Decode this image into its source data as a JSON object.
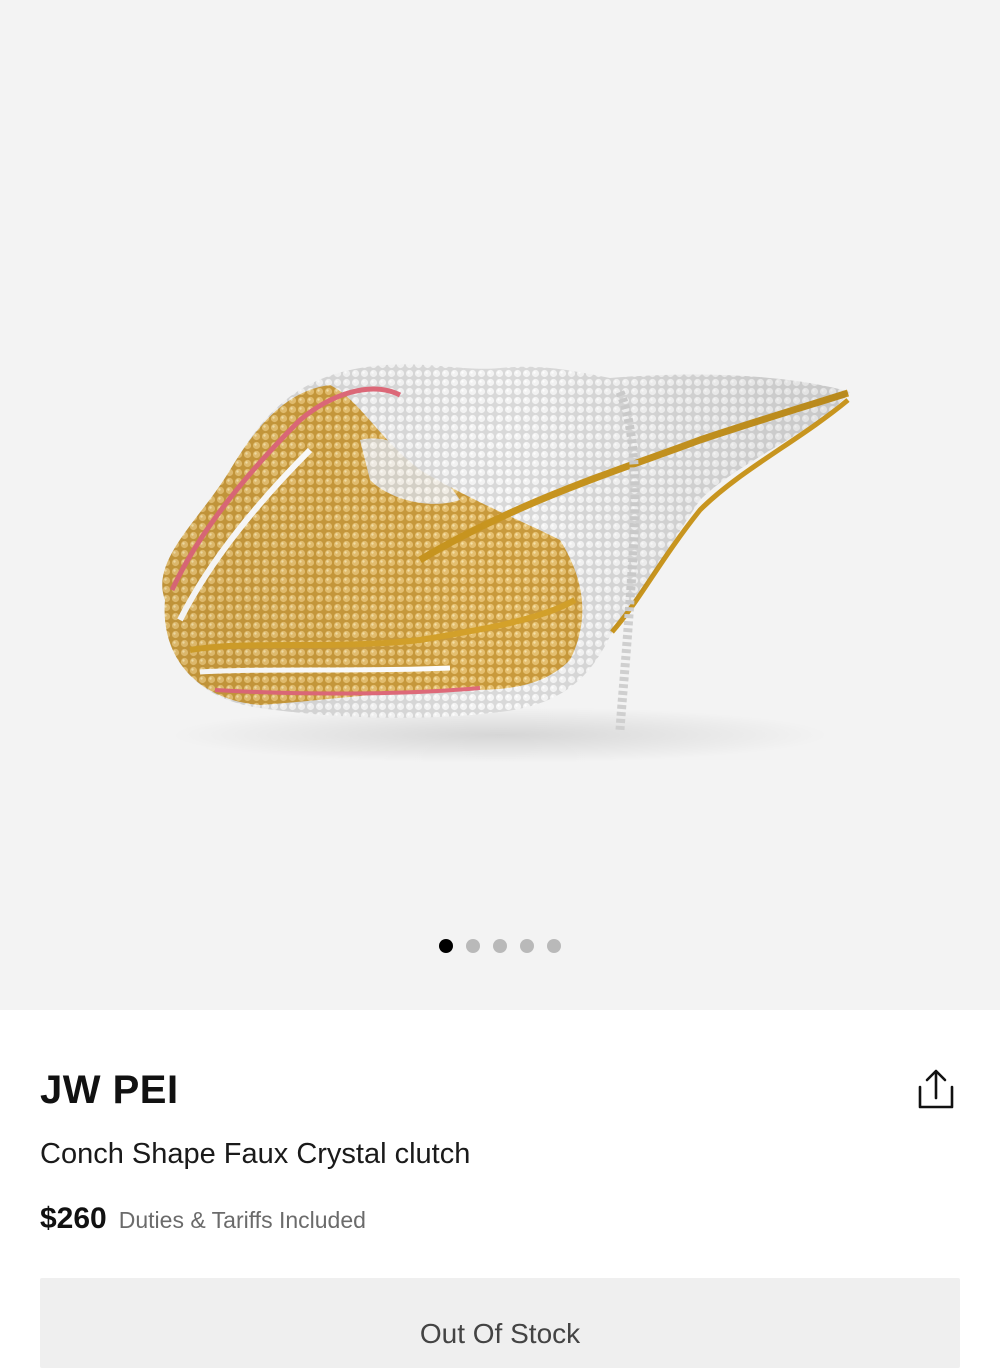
{
  "gallery": {
    "image_alt": "Conch shape crystal clutch product photo",
    "image_count": 5,
    "active_index": 0
  },
  "product": {
    "brand": "JW PEI",
    "name": "Conch Shape Faux Crystal clutch",
    "price": "$260",
    "duties_note": "Duties & Tariffs Included"
  },
  "actions": {
    "share_icon": "share-icon",
    "stock_button_label": "Out Of Stock"
  },
  "colors": {
    "gallery_bg": "#f3f3f3",
    "dot_active": "#000000",
    "dot_inactive": "#b9b9b9",
    "button_bg": "#efefef"
  }
}
